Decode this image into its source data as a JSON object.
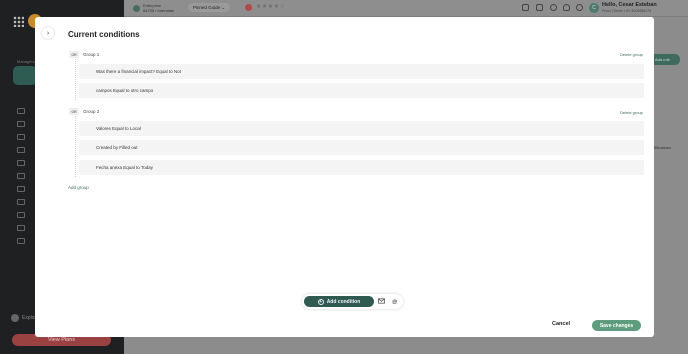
{
  "sidebar": {
    "section_label": "Management",
    "explore_label": "Explore",
    "view_plans_label": "View Plans"
  },
  "topbar": {
    "org_name": "Enterprise",
    "org_id": "84795 / Interstate",
    "pinned_guide": "Pinned Guide",
    "stars": "★★★★☆",
    "user_greeting": "Hello, Cesar Esteban",
    "user_sub": "Pricol | Demo • ID: 8003986174",
    "avatar_initial": "C"
  },
  "background": {
    "add_rule_label": "Add rule",
    "notifications_label": "notifications"
  },
  "modal": {
    "title": "Current conditions",
    "collapse_icon": "chevron-right",
    "groups": [
      {
        "operator": "OR",
        "name": "Group 1",
        "delete_label": "Delete group",
        "conditions": [
          "Was there a financial impact? Equal to Not",
          "campos Equal to otro campo"
        ]
      },
      {
        "operator": "OR",
        "name": "Group 2",
        "delete_label": "Delete group",
        "conditions": [
          "Valores Equal to Local",
          "Created by Filled out",
          "Fecha anexa Equal to Today"
        ]
      }
    ],
    "add_group_label": "Add group",
    "add_condition_label": "Add condition",
    "cancel_label": "Cancel",
    "save_label": "Save changes"
  },
  "colors": {
    "accent": "#2f5a4f",
    "save_button": "#5d9c7c",
    "link": "#3b6b5f",
    "view_plans": "#9a4141"
  }
}
